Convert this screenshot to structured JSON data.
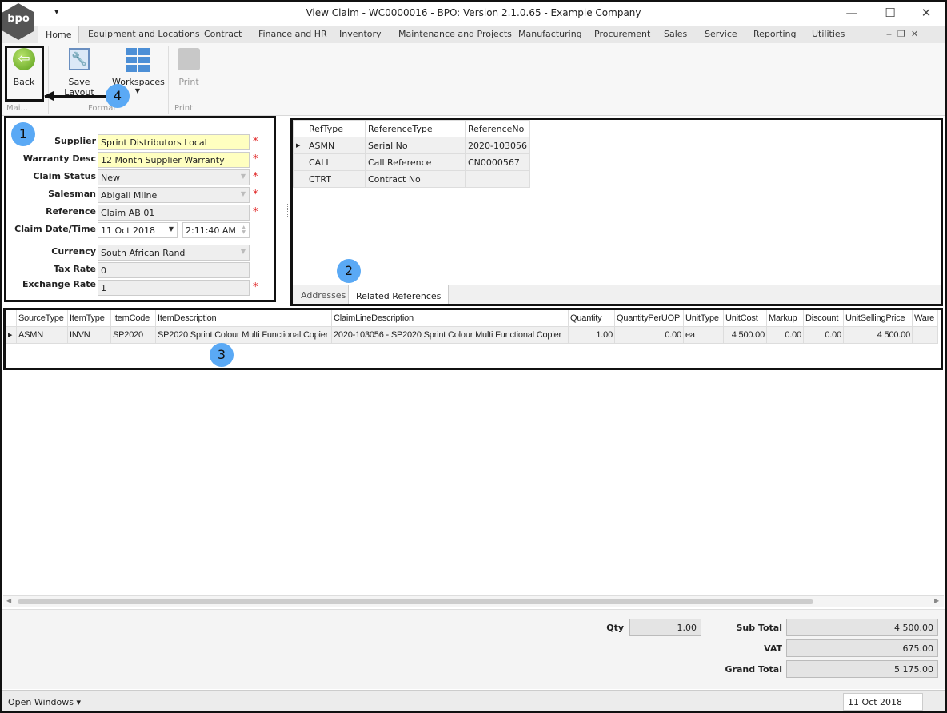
{
  "window": {
    "title": "View Claim - WC0000016 - BPO: Version 2.1.0.65 - Example Company",
    "logo_text": "bpo",
    "minimize": "—",
    "maximize": "☐",
    "close": "✕",
    "qat": "▾"
  },
  "tabs": [
    "Home",
    "Equipment and Locations",
    "Contract",
    "Finance and HR",
    "Inventory",
    "Maintenance and Projects",
    "Manufacturing",
    "Procurement",
    "Sales",
    "Service",
    "Reporting",
    "Utilities"
  ],
  "ribbon": {
    "back": "Back",
    "save_layout": "Save Layout",
    "workspaces": "Workspaces",
    "print": "Print",
    "groups": {
      "main": "Mai...",
      "format": "Format",
      "print": "Print"
    }
  },
  "form": {
    "supplier": {
      "label": "Supplier",
      "value": "Sprint Distributors Local"
    },
    "warranty_desc": {
      "label": "Warranty Desc",
      "value": "12 Month Supplier Warranty"
    },
    "claim_status": {
      "label": "Claim Status",
      "value": "New"
    },
    "salesman": {
      "label": "Salesman",
      "value": "Abigail Milne"
    },
    "reference": {
      "label": "Reference",
      "value": "Claim AB 01"
    },
    "claim_datetime": {
      "label": "Claim Date/Time",
      "date": "11 Oct 2018",
      "time": "2:11:40 AM"
    },
    "currency": {
      "label": "Currency",
      "value": "South African Rand"
    },
    "tax_rate": {
      "label": "Tax Rate",
      "value": "0"
    },
    "exchange_rate": {
      "label": "Exchange Rate",
      "value": "1"
    },
    "required_mark": "*"
  },
  "references": {
    "columns": [
      "RefType",
      "ReferenceType",
      "ReferenceNo"
    ],
    "rows": [
      [
        "ASMN",
        "Serial No",
        "2020-103056"
      ],
      [
        "CALL",
        "Call Reference",
        "CN0000567"
      ],
      [
        "CTRT",
        "Contract No",
        ""
      ]
    ],
    "tabs": [
      "Addresses",
      "Related References"
    ]
  },
  "lines": {
    "columns": [
      "SourceType",
      "ItemType",
      "ItemCode",
      "ItemDescription",
      "ClaimLineDescription",
      "Quantity",
      "QuantityPerUOP",
      "UnitType",
      "UnitCost",
      "Markup",
      "Discount",
      "UnitSellingPrice",
      "Ware"
    ],
    "rows": [
      [
        "ASMN",
        "INVN",
        "SP2020",
        "SP2020 Sprint Colour Multi Functional Copier",
        "2020-103056 - SP2020 Sprint Colour Multi Functional Copier",
        "1.00",
        "0.00",
        "ea",
        "4 500.00",
        "0.00",
        "0.00",
        "4 500.00",
        ""
      ]
    ]
  },
  "totals": {
    "qty_label": "Qty",
    "qty": "1.00",
    "sub_total_label": "Sub Total",
    "sub_total": "4 500.00",
    "vat_label": "VAT",
    "vat": "675.00",
    "grand_total_label": "Grand Total",
    "grand_total": "5 175.00"
  },
  "status": {
    "open_windows": "Open Windows ▾",
    "date": "11 Oct 2018"
  },
  "callouts": [
    "1",
    "2",
    "3",
    "4"
  ],
  "colors": {
    "required_field": "#ffffc0",
    "callout": "#5aa9f5",
    "required_star": "#e02020"
  }
}
